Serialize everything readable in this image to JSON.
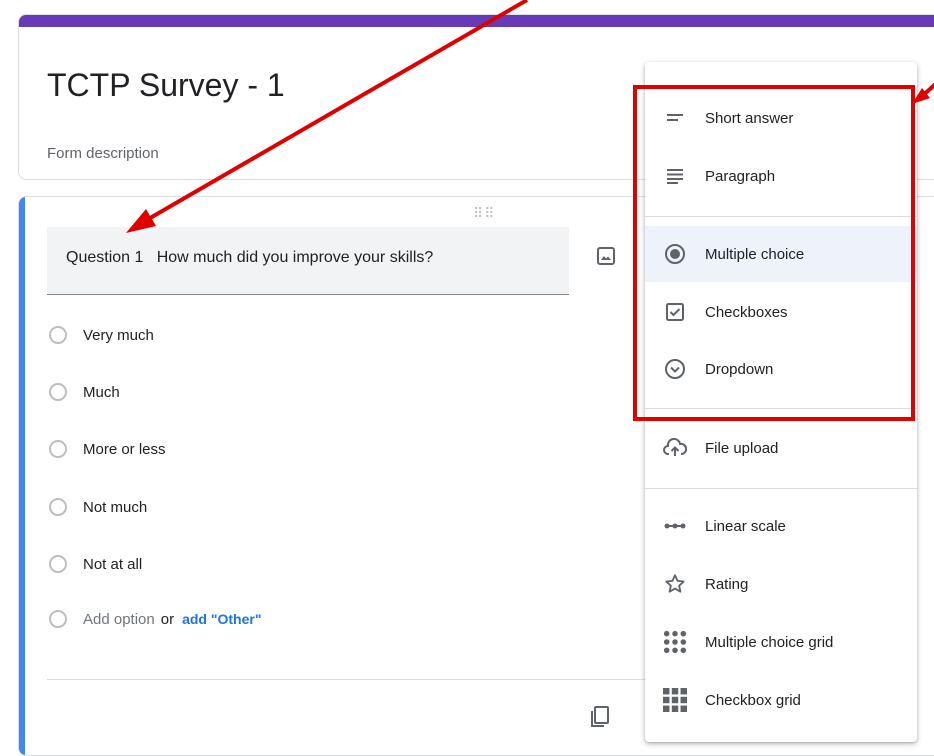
{
  "form": {
    "title": "TCTP Survey - 1",
    "description": "Form description"
  },
  "question": {
    "text": "Question 1   How much did you improve your skills?",
    "options": [
      "Very much",
      "Much",
      "More or less",
      "Not much",
      "Not at all"
    ],
    "add_option": "Add option",
    "or": "or",
    "add_other": "add \"Other\""
  },
  "menu": {
    "items": [
      {
        "label": "Short answer",
        "icon": "short-answer-icon"
      },
      {
        "label": "Paragraph",
        "icon": "paragraph-icon"
      },
      {
        "label": "Multiple choice",
        "icon": "radio-checked-icon",
        "selected": true
      },
      {
        "label": "Checkboxes",
        "icon": "checkbox-icon"
      },
      {
        "label": "Dropdown",
        "icon": "dropdown-circle-icon"
      },
      {
        "label": "File upload",
        "icon": "cloud-upload-icon"
      },
      {
        "label": "Linear scale",
        "icon": "linear-scale-icon"
      },
      {
        "label": "Rating",
        "icon": "star-icon"
      },
      {
        "label": "Multiple choice grid",
        "icon": "dots-grid-icon"
      },
      {
        "label": "Checkbox grid",
        "icon": "squares-grid-icon"
      }
    ]
  },
  "colors": {
    "theme_band": "#673ab7",
    "question_accent": "#4285f4",
    "annotation": "#e00000",
    "link": "#1a73e8"
  }
}
